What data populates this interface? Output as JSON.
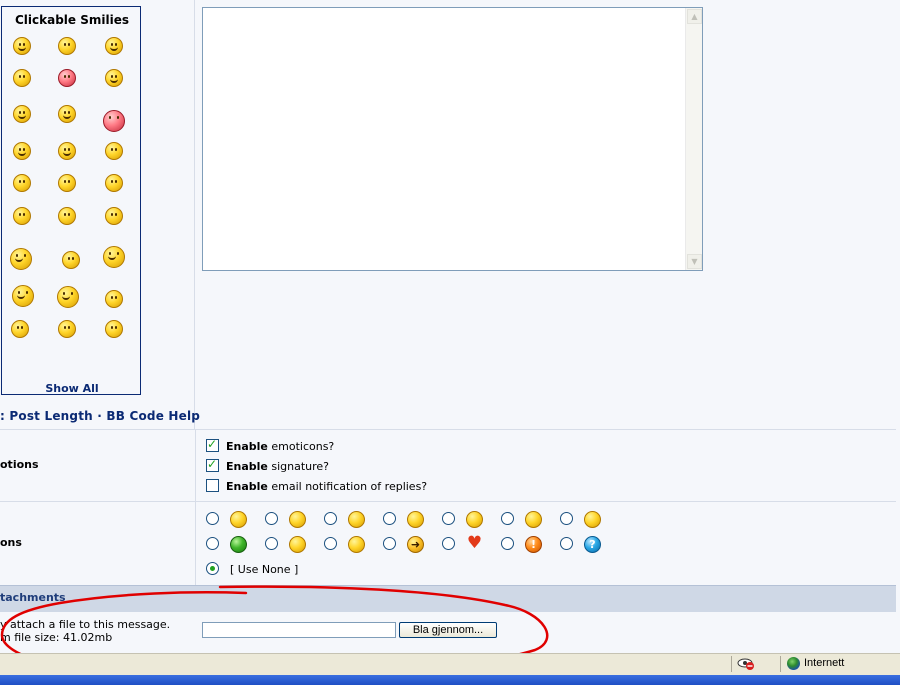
{
  "smilies": {
    "title": "Clickable Smilies",
    "show_all_label": "Show All"
  },
  "help_links": {
    "text": ": Post Length · BB Code Help"
  },
  "options": {
    "section_label": "otions",
    "items": [
      {
        "bold": "Enable",
        "rest": " emoticons?",
        "checked": true
      },
      {
        "bold": "Enable",
        "rest": " signature?",
        "checked": true
      },
      {
        "bold": "Enable",
        "rest": " email notification of replies?",
        "checked": false
      }
    ]
  },
  "post_icons": {
    "section_label": "ons",
    "use_none_label": "[ Use None ]"
  },
  "attachments": {
    "header_label": "tachments",
    "note_line1": "y attach a file to this message.",
    "note_line2": "m file size: 41.02mb",
    "browse_label": "Bla gjennom..."
  },
  "status_bar": {
    "zone_label": "Internett"
  },
  "colors": {
    "link": "#0b2a74",
    "annotation": "#e00000",
    "check_green": "#21a121"
  }
}
